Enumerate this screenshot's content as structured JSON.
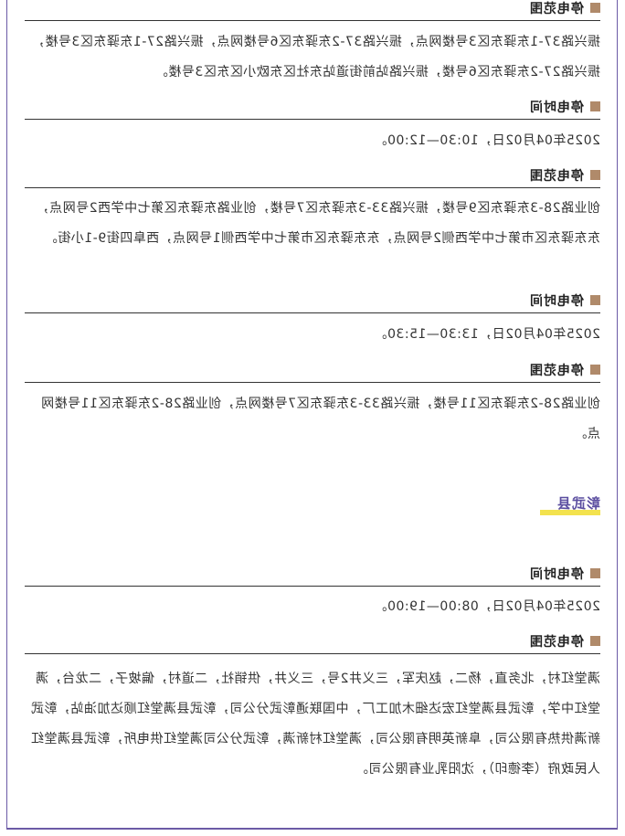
{
  "blocks": [
    {
      "head": "停电范围",
      "text": "振兴路37-1东驿东区3号楼网点，振兴路37-2东驿东区6号楼网点，振兴路27-1东驿东区3号楼，振兴路27-2东驿东区6号楼，振兴路站前街道站东社区东欧小区东区3号楼。"
    },
    {
      "head": "停电时间",
      "text": "2025年04月02日，10:30—12:00。"
    },
    {
      "head": "停电范围",
      "text": "创业路28-3东驿东区9号楼，振兴路33-3东驿东区7号楼，创业路东驿东区第七中学西2号网点，东东驿东区市第七中学西侧2号网点，东东驿东区市第七中学西侧1号网点，西阜四街9-1小街。"
    },
    {
      "head": "停电时间",
      "text": "2025年04月02日，13:30—15:30。"
    },
    {
      "head": "停电范围",
      "text": "创业路28-2东驿东区11号楼，振兴路33-3东驿东区7号楼网点，创业路28-2东驿东区11号楼网点。"
    }
  ],
  "county": "彰武县",
  "county_blocks": [
    {
      "head": "停电时间",
      "text": "2025年04月02日，08:00—19:00。"
    },
    {
      "head": "停电范围",
      "text": "满堂红村，北务直，杨二，赵庆军，三义井2号，三义井，供销社，二道村，偏坡子，二龙台，满堂红中学，彰武县满堂红宏达细木加工厂，中国联通彰武分公司，彰武县满堂红顺达加油站，彰武新满供热有限公司，阜新英明有限公司，满堂红村新满，彰武分公司满堂红供电所，彰武县满堂红人民政府（李德印），沈阳乳业有限公司。"
    }
  ]
}
